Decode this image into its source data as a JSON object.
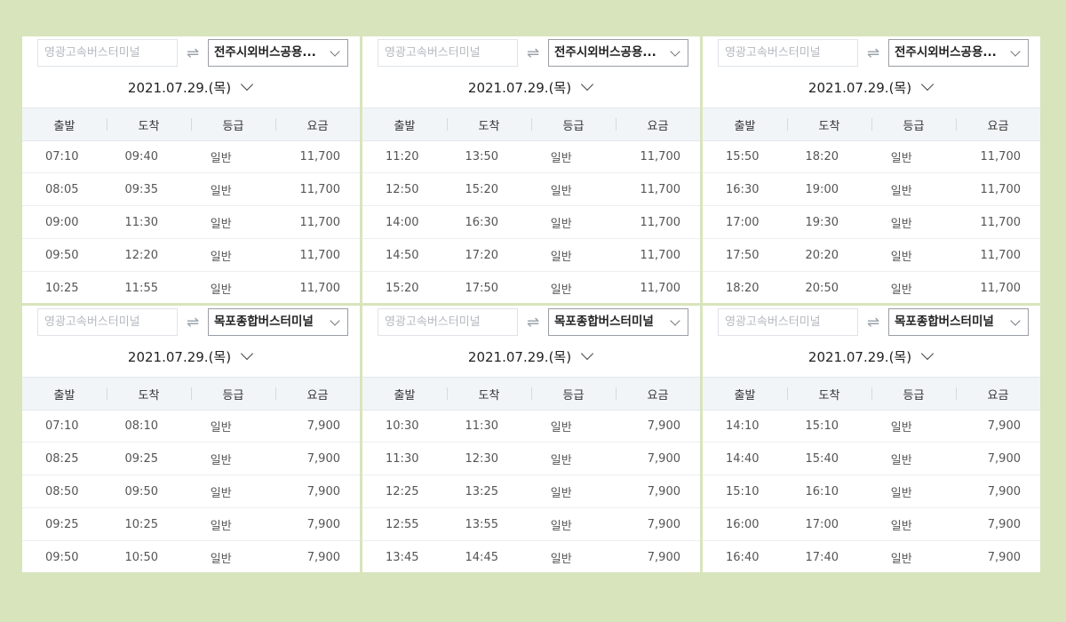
{
  "headers": [
    "출발",
    "도착",
    "등급",
    "요금"
  ],
  "panels": [
    {
      "from_placeholder": "영광고속버스터미널",
      "to": "전주시외버스공용...",
      "date": "2021.07.29.(목)",
      "rows": [
        [
          "07:10",
          "09:40",
          "일반",
          "11,700"
        ],
        [
          "08:05",
          "09:35",
          "일반",
          "11,700"
        ],
        [
          "09:00",
          "11:30",
          "일반",
          "11,700"
        ],
        [
          "09:50",
          "12:20",
          "일반",
          "11,700"
        ],
        [
          "10:25",
          "11:55",
          "일반",
          "11,700"
        ]
      ]
    },
    {
      "from_placeholder": "영광고속버스터미널",
      "to": "전주시외버스공용...",
      "date": "2021.07.29.(목)",
      "rows": [
        [
          "11:20",
          "13:50",
          "일반",
          "11,700"
        ],
        [
          "12:50",
          "15:20",
          "일반",
          "11,700"
        ],
        [
          "14:00",
          "16:30",
          "일반",
          "11,700"
        ],
        [
          "14:50",
          "17:20",
          "일반",
          "11,700"
        ],
        [
          "15:20",
          "17:50",
          "일반",
          "11,700"
        ]
      ]
    },
    {
      "from_placeholder": "영광고속버스터미널",
      "to": "전주시외버스공용...",
      "date": "2021.07.29.(목)",
      "rows": [
        [
          "15:50",
          "18:20",
          "일반",
          "11,700"
        ],
        [
          "16:30",
          "19:00",
          "일반",
          "11,700"
        ],
        [
          "17:00",
          "19:30",
          "일반",
          "11,700"
        ],
        [
          "17:50",
          "20:20",
          "일반",
          "11,700"
        ],
        [
          "18:20",
          "20:50",
          "일반",
          "11,700"
        ]
      ]
    },
    {
      "from_placeholder": "영광고속버스터미널",
      "to": "목포종합버스터미널",
      "date": "2021.07.29.(목)",
      "rows": [
        [
          "07:10",
          "08:10",
          "일반",
          "7,900"
        ],
        [
          "08:25",
          "09:25",
          "일반",
          "7,900"
        ],
        [
          "08:50",
          "09:50",
          "일반",
          "7,900"
        ],
        [
          "09:25",
          "10:25",
          "일반",
          "7,900"
        ],
        [
          "09:50",
          "10:50",
          "일반",
          "7,900"
        ]
      ]
    },
    {
      "from_placeholder": "영광고속버스터미널",
      "to": "목포종합버스터미널",
      "date": "2021.07.29.(목)",
      "rows": [
        [
          "10:30",
          "11:30",
          "일반",
          "7,900"
        ],
        [
          "11:30",
          "12:30",
          "일반",
          "7,900"
        ],
        [
          "12:25",
          "13:25",
          "일반",
          "7,900"
        ],
        [
          "12:55",
          "13:55",
          "일반",
          "7,900"
        ],
        [
          "13:45",
          "14:45",
          "일반",
          "7,900"
        ]
      ]
    },
    {
      "from_placeholder": "영광고속버스터미널",
      "to": "목포종합버스터미널",
      "date": "2021.07.29.(목)",
      "rows": [
        [
          "14:10",
          "15:10",
          "일반",
          "7,900"
        ],
        [
          "14:40",
          "15:40",
          "일반",
          "7,900"
        ],
        [
          "15:10",
          "16:10",
          "일반",
          "7,900"
        ],
        [
          "16:00",
          "17:00",
          "일반",
          "7,900"
        ],
        [
          "16:40",
          "17:40",
          "일반",
          "7,900"
        ]
      ]
    }
  ],
  "icons": {
    "swap": "swap-arrows-icon",
    "dropdown": "chevron-down-icon",
    "date_picker": "chevron-down-icon"
  },
  "colors": {
    "page_background": "#d8e4bc",
    "header_background": "#f2f5f8",
    "panel_background": "#ffffff"
  }
}
